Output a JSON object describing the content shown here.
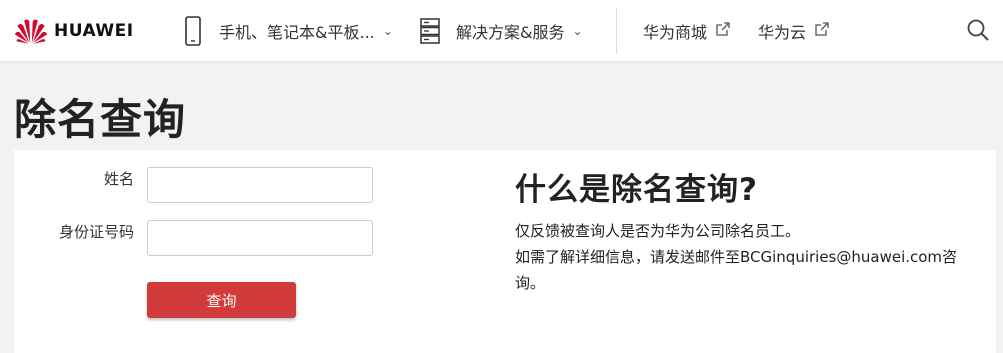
{
  "header": {
    "brand": "HUAWEI",
    "nav": [
      {
        "label": "手机、笔记本&平板...",
        "icon": "smartphone-icon",
        "dropdown": true
      },
      {
        "label": "解决方案&服务",
        "icon": "server-icon",
        "dropdown": true
      },
      {
        "label": "华为商城",
        "icon": "external-link-icon"
      },
      {
        "label": "华为云",
        "icon": "external-link-icon"
      }
    ],
    "search_icon": "search-icon",
    "brand_color": "#cf0a2c"
  },
  "page": {
    "title": "除名查询"
  },
  "form": {
    "name_label": "姓名",
    "name_value": "",
    "id_label": "身份证号码",
    "id_value": "",
    "submit_label": "查询",
    "submit_color": "#d23b3b"
  },
  "info": {
    "title": "什么是除名查询?",
    "line1": "仅反馈被查询人是否为华为公司除名员工。",
    "line2": "如需了解详细信息，请发送邮件至BCGinquiries@huawei.com咨",
    "line3": "询。"
  }
}
